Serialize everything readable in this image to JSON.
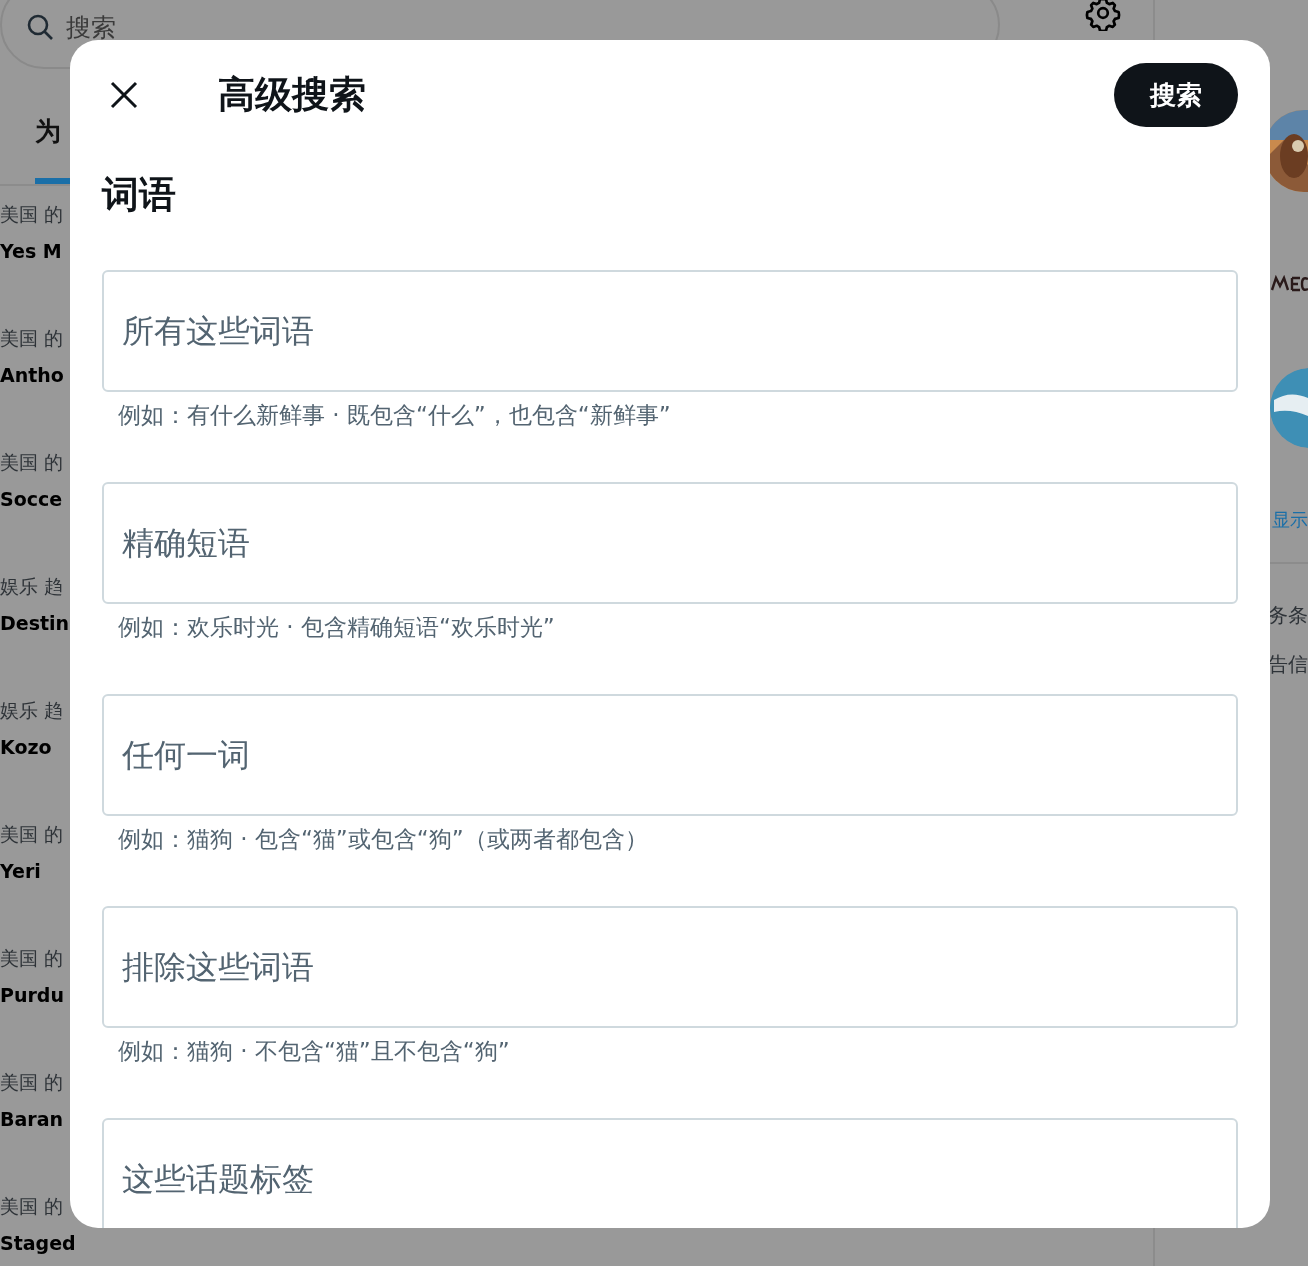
{
  "background": {
    "search": {
      "placeholder": "搜索"
    },
    "tab": {
      "label": "为",
      "selected": true
    },
    "trends": [
      {
        "category": "美国 的",
        "title": "Yes M"
      },
      {
        "category": "美国 的",
        "title": "Antho"
      },
      {
        "category": "美国 的",
        "title": "Socce"
      },
      {
        "category": "娱乐 趋",
        "title": "Destin"
      },
      {
        "category": "娱乐 趋",
        "title": "Kozo"
      },
      {
        "category": "美国 的",
        "title": "Yeri"
      },
      {
        "category": "美国 的",
        "title": "Purdu"
      },
      {
        "category": "美国 的",
        "title": "Baran"
      },
      {
        "category": "美国 的",
        "title": "Staged"
      }
    ],
    "side": {
      "show_more": "显示",
      "links": [
        "务条",
        "告信"
      ]
    }
  },
  "dialog": {
    "title": "高级搜索",
    "search_button": "搜索",
    "section": "词语",
    "fields": [
      {
        "placeholder": "所有这些词语",
        "hint": "例如：有什么新鲜事 · 既包含“什么”，也包含“新鲜事”"
      },
      {
        "placeholder": "精确短语",
        "hint": "例如：欢乐时光 · 包含精确短语“欢乐时光”"
      },
      {
        "placeholder": "任何一词",
        "hint": "例如：猫狗 · 包含“猫”或包含“狗”（或两者都包含）"
      },
      {
        "placeholder": "排除这些词语",
        "hint": "例如：猫狗 · 不包含“猫”且不包含“狗”"
      },
      {
        "placeholder": "这些话题标签"
      }
    ]
  }
}
